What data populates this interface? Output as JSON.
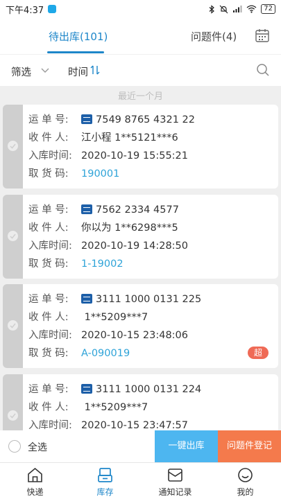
{
  "status_bar": {
    "time": "下午4:37",
    "battery": "72"
  },
  "tabs": [
    {
      "label": "待出库(101)",
      "active": true
    },
    {
      "label": "问题件(4)",
      "active": false
    }
  ],
  "filters": {
    "filter_label": "筛选",
    "sort_label": "时间",
    "sort_glyph": "⇅"
  },
  "range_label": "最近一个月",
  "field_labels": {
    "waybill": "运 单 号:",
    "recipient": "收 件 人:",
    "inbound_time": "入库时间:",
    "pickup_code": "取 货 码:"
  },
  "packages": [
    {
      "waybill": "7549 8765 4321 22",
      "recipient": "江小程 1**5121***6",
      "inbound_time": "2020-10-19 15:55:21",
      "pickup_code": "190001",
      "badge": ""
    },
    {
      "waybill": "7562 2334 4577",
      "recipient": "你以为 1**6298***5",
      "inbound_time": "2020-10-19 14:28:50",
      "pickup_code": "1-19002",
      "badge": ""
    },
    {
      "waybill": "3111 1000 0131 225",
      "recipient": " 1**5209***7",
      "inbound_time": "2020-10-15 23:48:06",
      "pickup_code": "A-090019",
      "badge": "超"
    },
    {
      "waybill": "3111 1000 0131 224",
      "recipient": " 1**5209***7",
      "inbound_time": "2020-10-15 23:47:57",
      "pickup_code": "",
      "badge": ""
    }
  ],
  "action_bar": {
    "select_all": "全选",
    "one_click_outbound": "一键出库",
    "problem_register": "问题件登记"
  },
  "bottom_nav": [
    {
      "label": "快递",
      "icon": "home-icon",
      "active": false
    },
    {
      "label": "库存",
      "icon": "inventory-icon",
      "active": true
    },
    {
      "label": "通知记录",
      "icon": "notification-icon",
      "active": false
    },
    {
      "label": "我的",
      "icon": "profile-icon",
      "active": false
    }
  ],
  "colors": {
    "accent": "#1d86c9",
    "pickup_code": "#2ea3d8",
    "outbound_button": "#4db6f0",
    "problem_button": "#f47a4c",
    "badge": "#ef6a56"
  }
}
